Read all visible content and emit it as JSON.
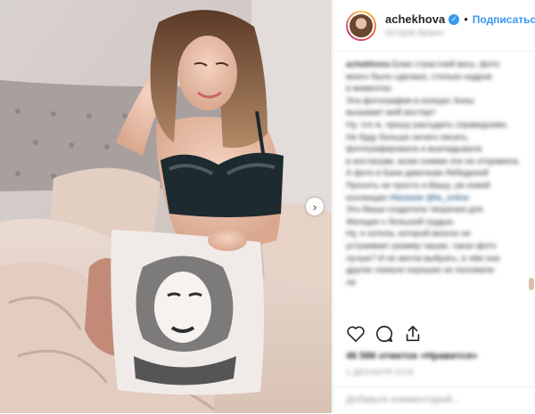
{
  "header": {
    "username": "achekhova",
    "separator": "•",
    "follow_label": "Подписаться",
    "location": "Остров Бранч"
  },
  "caption": {
    "author": "achekhova",
    "lines": [
      "Боже страстней весь, фото",
      "много было сделано, столько кадров",
      "в моментах",
      "Эта фотография в конкурс Анны",
      "вызывает мой восторг!",
      "Ну, что ж, прошу рассудить справедливо.",
      "Не буду больше ничего писать,",
      "фотографировала и выкладывала",
      "в инстаграм, всем снимки эти не отправила.",
      "А фото в Бане девочкам Лебединой",
      "Просить не просто и Вашу, уж новой",
      "коллекции",
      "Это Ваша создатели творения для",
      "Женщин с большой грудью.",
      "Ну, я хотела, которой многих не",
      "устраивает размер чашки, такое фото",
      "лучше? И не могла выбрать, в чём они",
      "другие лежали хорошие не положили",
      "ли"
    ],
    "hashtag_1": "#fantasie",
    "hashtag_2": "@fa_online"
  },
  "actions": {
    "like_icon": "heart-icon",
    "comment_icon": "comment-icon",
    "share_icon": "share-icon"
  },
  "likes_text": "46 586 отметок «Нравится»",
  "date_text": "1 ДЕКАБРЯ 2018",
  "comment_placeholder": "Добавьте комментарий...",
  "media": {
    "description_icon": "chevron-right-icon",
    "carousel_glyph": "›"
  }
}
